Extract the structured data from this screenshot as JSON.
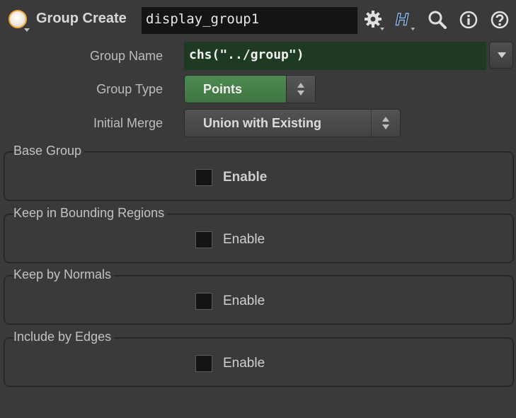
{
  "header": {
    "node_type": "Group Create",
    "node_name": "display_group1",
    "icons": [
      "gear-icon",
      "houdini-h-icon",
      "search-icon",
      "info-icon",
      "help-icon"
    ]
  },
  "parms": {
    "group_name": {
      "label": "Group Name",
      "value": "chs(\"../group\")"
    },
    "group_type": {
      "label": "Group Type",
      "value": "Points"
    },
    "initial_merge": {
      "label": "Initial Merge",
      "value": "Union with Existing"
    }
  },
  "folders": [
    {
      "title": "Base Group",
      "checkbox_label": "Enable"
    },
    {
      "title": "Keep in Bounding Regions",
      "checkbox_label": "Enable"
    },
    {
      "title": "Keep by Normals",
      "checkbox_label": "Enable"
    },
    {
      "title": "Include by Edges",
      "checkbox_label": "Enable"
    }
  ],
  "colors": {
    "background": "#3a3a3a",
    "field_dark": "#141414",
    "expression_green": "#1f3a22",
    "menu_green": "#4f8a52",
    "node_icon_ring": "#f0a53a"
  }
}
